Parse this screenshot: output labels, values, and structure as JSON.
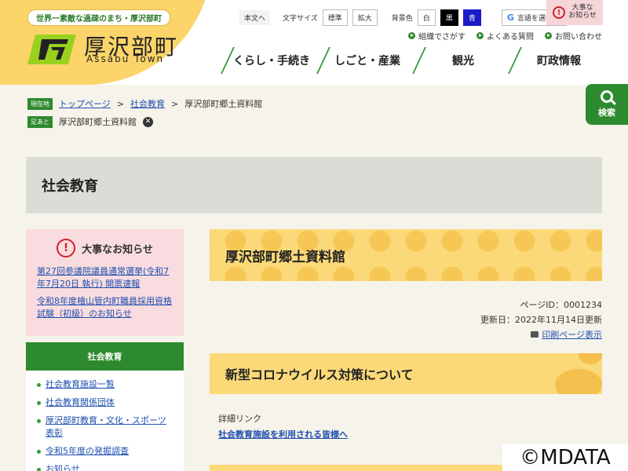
{
  "header": {
    "tagline": "世界一素敵な過疎のまち・厚沢部町",
    "logo_title": "厚沢部町",
    "logo_sub": "Assabu Town",
    "tools": {
      "skip": "本文へ",
      "font_size_label": "文字サイズ",
      "font_normal": "標準",
      "font_large": "拡大",
      "bg_label": "背景色",
      "bg_white": "白",
      "bg_black": "黒",
      "bg_blue": "青",
      "language": "言語を選択"
    },
    "important": "大事な\nお知らせ",
    "util_links": [
      "組織でさがす",
      "よくある質問",
      "お問い合わせ"
    ],
    "gnav": [
      "くらし・手続き",
      "しごと・産業",
      "観光",
      "町政情報"
    ],
    "search": "検索",
    "colors": {
      "green": "#2e8a2e",
      "yellow": "#fbd978"
    }
  },
  "breadcrumb": {
    "current_tag": "現在地",
    "home": "トップページ",
    "section": "社会教育",
    "current": "厚沢部町郷土資料館",
    "footprint_tag": "足あと",
    "footprint_item": "厚沢部町郷土資料館"
  },
  "page_title": "社会教育",
  "sidebar": {
    "notice_title": "大事なお知らせ",
    "notices": [
      "第27回参議院議員通常選挙(令和7年7月20日 執行) 開票速報",
      "令和8年度檜山管内町職員採用資格試験（初級）のお知らせ"
    ],
    "nav_title": "社会教育",
    "nav_items": [
      "社会教育施設一覧",
      "社会教育関係団体",
      "厚沢部町教育・文化・スポーツ表彰",
      "令和5年度の発掘調査",
      "お知らせ"
    ]
  },
  "main": {
    "title": "厚沢部町郷土資料館",
    "page_id": "ページID：0001234",
    "updated": "更新日：2022年11月14日更新",
    "print": "印刷ページ表示",
    "section_title": "新型コロナウイルス対策について",
    "detail_label": "詳細リンク",
    "detail_link": "社会教育施設を利用される皆様へ"
  },
  "copyright": "©MDATA"
}
